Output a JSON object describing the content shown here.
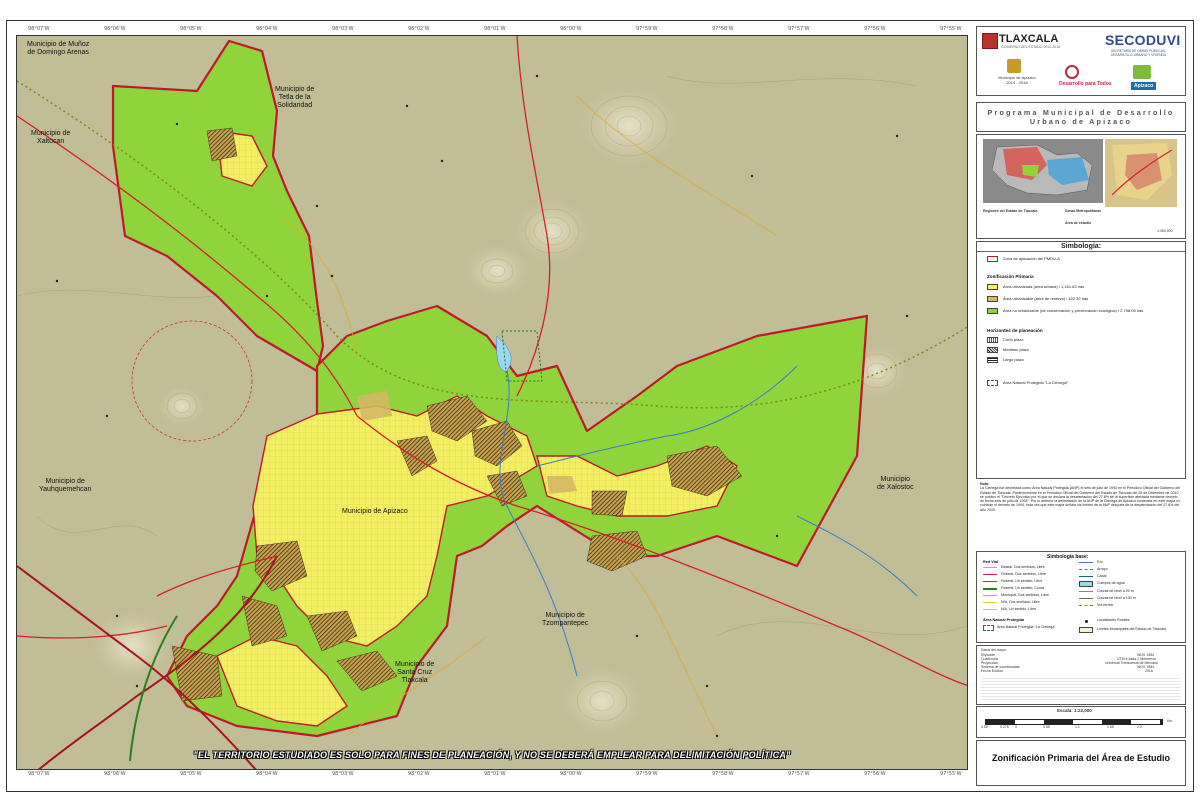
{
  "municipalities": [
    {
      "name": "Municipio de Muñoz\nde Domingo Arenas",
      "id": "munoz"
    },
    {
      "name": "Municipio de\nTetla de la\nSolidaridad",
      "id": "tetla"
    },
    {
      "name": "Municipio de\nXaltocan",
      "id": "xaltocan"
    },
    {
      "name": "Municipio de\nYauhquemehcan",
      "id": "yauh"
    },
    {
      "name": "Municipio de Apizaco",
      "id": "apizaco"
    },
    {
      "name": "Municipio\nde Xalostoc",
      "id": "xalostoc"
    },
    {
      "name": "Municipio de\nTzompantepec",
      "id": "tzomp"
    },
    {
      "name": "Municipio de\nSanta Cruz\nTlaxcala",
      "id": "santacruz"
    }
  ],
  "disclaimer": "\"EL TERRITORIO ESTUDIADO ES SOLO PARA FINES DE PLANEACIÓN, Y NO SE DEBERÁ EMPLEAR PARA DELIMITACIÓN POLÍTICA\"",
  "panel": {
    "logo_left": "TLAXCALA",
    "logo_left_sub": "GOBIERNO DEL ESTADO 2011-2016",
    "logo_right": "SECODUVI",
    "logo_right_sub": "SECRETARÍA DE OBRAS PÚBLICAS, DESARROLLO URBANO Y VIVIENDA",
    "logo_mun": "Municipio de Apizaco 2014 - 2016",
    "logo_des": "Desarrollo para Todos",
    "logo_api": "Apizaco",
    "title_line1": "Programa Municipal de Desarrollo",
    "title_line2": "Urbano de Apizaco",
    "inset_legend_1": "Regiones del Estado de Tlaxcala",
    "inset_legend_2": "Zonas Metropolitanas",
    "inset_area": "Área de estudio",
    "inset_scale": "1:450,000",
    "simbologia_title": "Simbología:",
    "limit_label": "Zona de aplicación del PMDU-A",
    "zon_title": "Zonificación Primaria",
    "zon_items": [
      "Área urbanizada (área urbana) / 1,161.63 has",
      "Área urbanizable (área de reserva) / 402.32 has",
      "Área no urbanizable (de conservación y preservación ecológica) / 2,798.05 has"
    ],
    "horiz_title": "Horizontes de planeación",
    "horiz_items": [
      "Corto plazo",
      "Mediano plazo",
      "Largo plazo"
    ],
    "anp_label": "Área Natural Protegida \"La Ciénega\"",
    "note_title": "Nota:",
    "note_text": "La Ciénega fue decretada como Área Natural Protegida (ANP) el seis de julio de 1994 en el Periódico Oficial del Gobierno del Estado de Tlaxcala. Posteriormente en el Periódico Oficial del Gobierno del Estado de Tlaxcala del 26 de Diciembre de 2010 se publicó el \"Decreto Ejecutivo por el que se declara la desafectación del 27.8% de la superficie afectada mediante decreto de fecha seis de julio de 1994\". Por lo anterior la delimitación de la ANP de la Ciénega de Apizaco contenida en este mapa no coincide el decreto de 1994, toda vez que este mapa señala los límites de la ANP después de la desafectación del 27.8% del año 2010.",
    "base_title": "Simbología base:",
    "red_vial": "Red Vial",
    "roads": [
      "Estatal, Dos sentidos, Libre",
      "Federal, Dos sentidos, Libre",
      "Federal, Un sentido, Libre",
      "Federal, Un sentido, Cuota",
      "Municipal, Dos sentidos, Libre",
      "N/A, Dos sentidos, Libre",
      "N/A, Un sentido, Libre"
    ],
    "base_items": [
      "Río",
      "Arroyo",
      "Canal",
      "Cuerpos de agua",
      "Curvas de nivel a 20 m",
      "Curvas de nivel a 100 m",
      "Vía férrea"
    ],
    "anp_title": "Área Natural Protegida",
    "anp_base": "Área Natural Protegida \"La Ciénega\"",
    "loc_rural": "Localidades Rurales",
    "limites": "Límites Municipales del Estado de Tlaxcala",
    "meta_title": "Datos del mapa:",
    "meta_rows": [
      [
        "Elipsoide",
        "WGS 1984"
      ],
      [
        "Cuadrícula",
        "UTM a cada 2 kilómetros"
      ],
      [
        "Proyección",
        "Universal Transversal de Mercator"
      ],
      [
        "Sistema de coordenadas",
        "WGS 1984"
      ],
      [
        "Fecha Edición",
        "2016"
      ]
    ],
    "scale_label": "Escala:  1:22,000",
    "scale_ticks": [
      "0.55",
      "0.275",
      "0",
      "0.55",
      "1.1",
      "1.65",
      "2.2"
    ],
    "scale_unit": "Km",
    "footer_title": "Zonificación Primaria del Área de Estudio"
  },
  "ticks_top": [
    "98°07'W",
    "98°06'W",
    "98°05'W",
    "98°04'W",
    "98°03'W",
    "98°02'W",
    "98°01'W",
    "98°00'W",
    "97°59'W",
    "97°58'W",
    "97°57'W",
    "97°56'W",
    "97°55'W"
  ],
  "colors": {
    "terrain": "#c9c4a2",
    "nonurban": "#8fd43a",
    "urban": "#f2ef63",
    "reserve": "#d4b866",
    "limit": "#c0182b",
    "road_fed": "#d41f2c",
    "road_mun": "#e8a628",
    "rail": "#7a8b1e",
    "river": "#3a7cc8"
  }
}
